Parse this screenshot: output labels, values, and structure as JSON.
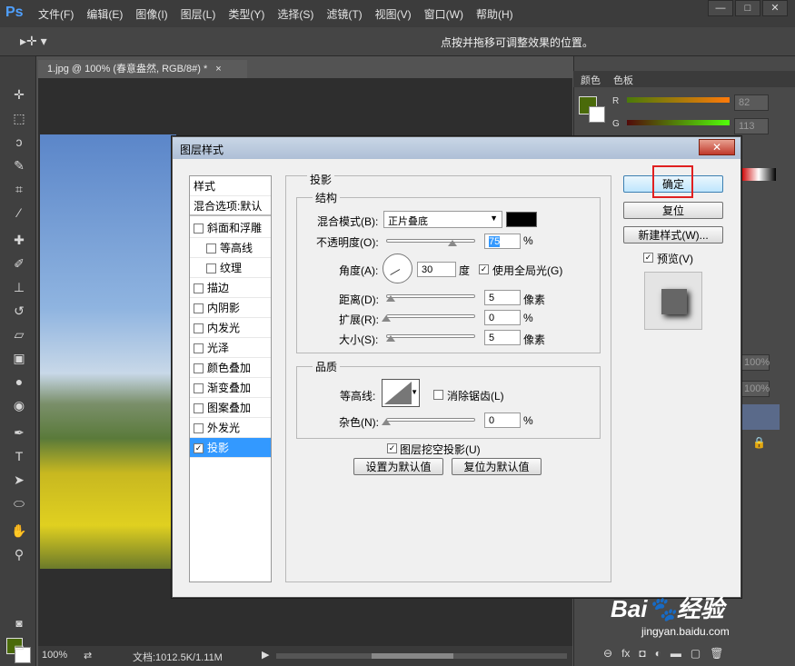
{
  "app": {
    "logo": "Ps"
  },
  "menu": [
    "文件(F)",
    "编辑(E)",
    "图像(I)",
    "图层(L)",
    "类型(Y)",
    "选择(S)",
    "滤镜(T)",
    "视图(V)",
    "窗口(W)",
    "帮助(H)"
  ],
  "window_buttons": [
    "—",
    "□",
    "✕"
  ],
  "options_bar": {
    "hint": "点按并拖移可调整效果的位置。"
  },
  "document": {
    "tab": "1.jpg @ 100% (春意盎然, RGB/8#) *",
    "close": "×"
  },
  "status": {
    "zoom": "100%",
    "doc_size": "文档:1012.5K/1.11M"
  },
  "right_panel": {
    "tabs": [
      "颜色",
      "色板"
    ],
    "channels": [
      {
        "label": "R",
        "value": "82"
      },
      {
        "label": "G",
        "value": "113"
      }
    ],
    "opacity_values": [
      "100%",
      "100%"
    ],
    "foreground_color": "#4a6a0a"
  },
  "dialog": {
    "title": "图层样式",
    "close": "✕",
    "styles_header": "样式",
    "blend_options": "混合选项:默认",
    "styles": [
      {
        "label": "斜面和浮雕",
        "checked": false,
        "indent": false
      },
      {
        "label": "等高线",
        "checked": false,
        "indent": true
      },
      {
        "label": "纹理",
        "checked": false,
        "indent": true
      },
      {
        "label": "描边",
        "checked": false,
        "indent": false
      },
      {
        "label": "内阴影",
        "checked": false,
        "indent": false
      },
      {
        "label": "内发光",
        "checked": false,
        "indent": false
      },
      {
        "label": "光泽",
        "checked": false,
        "indent": false
      },
      {
        "label": "颜色叠加",
        "checked": false,
        "indent": false
      },
      {
        "label": "渐变叠加",
        "checked": false,
        "indent": false
      },
      {
        "label": "图案叠加",
        "checked": false,
        "indent": false
      },
      {
        "label": "外发光",
        "checked": false,
        "indent": false
      },
      {
        "label": "投影",
        "checked": true,
        "indent": false
      }
    ],
    "section_title": "投影",
    "structure": {
      "title": "结构",
      "blend_mode_label": "混合模式(B):",
      "blend_mode_value": "正片叠底",
      "opacity_label": "不透明度(O):",
      "opacity_value": "75",
      "opacity_unit": "%",
      "angle_label": "角度(A):",
      "angle_value": "30",
      "angle_unit": "度",
      "global_light_label": "使用全局光(G)",
      "distance_label": "距离(D):",
      "distance_value": "5",
      "distance_unit": "像素",
      "spread_label": "扩展(R):",
      "spread_value": "0",
      "spread_unit": "%",
      "size_label": "大小(S):",
      "size_value": "5",
      "size_unit": "像素"
    },
    "quality": {
      "title": "品质",
      "contour_label": "等高线:",
      "antialias_label": "消除锯齿(L)",
      "noise_label": "杂色(N):",
      "noise_value": "0",
      "noise_unit": "%"
    },
    "knockout_label": "图层挖空投影(U)",
    "make_default": "设置为默认值",
    "reset_default": "复位为默认值",
    "ok": "确定",
    "reset": "复位",
    "new_style": "新建样式(W)...",
    "preview_label": "预览(V)"
  },
  "watermark": {
    "brand": "Bai",
    "brand2": "经验",
    "url": "jingyan.baidu.com"
  }
}
